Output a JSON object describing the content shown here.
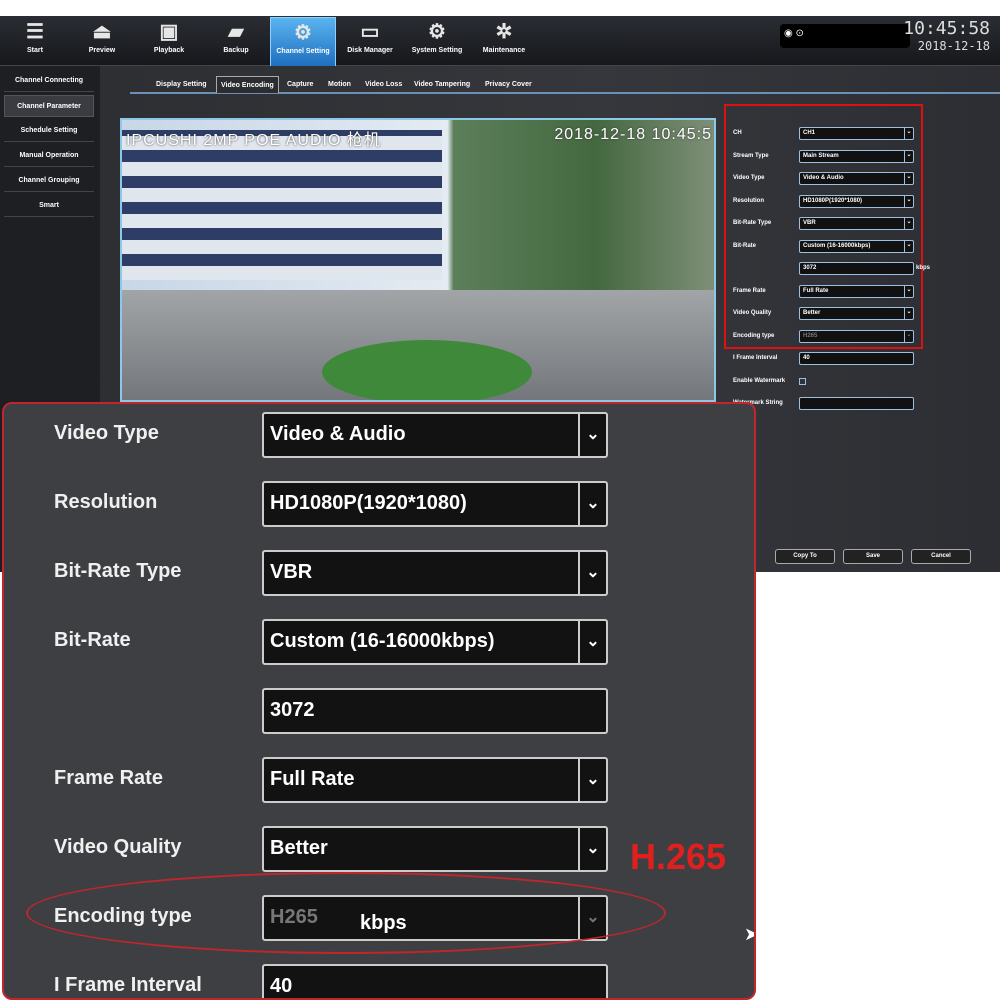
{
  "nav": [
    {
      "label": "Start",
      "icon": "list-icon"
    },
    {
      "label": "Preview",
      "icon": "camera-icon"
    },
    {
      "label": "Playback",
      "icon": "film-icon"
    },
    {
      "label": "Backup",
      "icon": "folder-icon"
    },
    {
      "label": "Channel Setting",
      "icon": "channel-gear-icon",
      "active": true
    },
    {
      "label": "Disk Manager",
      "icon": "disk-icon"
    },
    {
      "label": "System Setting",
      "icon": "system-gear-icon"
    },
    {
      "label": "Maintenance",
      "icon": "gear-icon"
    }
  ],
  "clock": {
    "time": "10:45:58",
    "date": "2018-12-18"
  },
  "sidebar": [
    "Channel Connecting",
    "Channel Parameter",
    "Schedule Setting",
    "Manual Operation",
    "Channel Grouping",
    "Smart"
  ],
  "tabs": [
    "Display Setting",
    "Video Encoding",
    "Capture",
    "Motion",
    "Video Loss",
    "Video Tampering",
    "Privacy Cover"
  ],
  "preview": {
    "osd_name": "IPCUSHI 2MP POE AUDIO 枪机",
    "osd_time": "2018-12-18 10:45:5"
  },
  "form": {
    "fields": [
      {
        "label": "CH",
        "value": "CH1",
        "type": "select"
      },
      {
        "label": "Stream Type",
        "value": "Main Stream",
        "type": "select"
      },
      {
        "label": "Video Type",
        "value": "Video & Audio",
        "type": "select"
      },
      {
        "label": "Resolution",
        "value": "HD1080P(1920*1080)",
        "type": "select"
      },
      {
        "label": "Bit-Rate Type",
        "value": "VBR",
        "type": "select"
      },
      {
        "label": "Bit-Rate",
        "value": "Custom (16-16000kbps)",
        "type": "select"
      },
      {
        "label": "",
        "value": "3072",
        "type": "input"
      },
      {
        "label": "Frame Rate",
        "value": "Full Rate",
        "type": "select"
      },
      {
        "label": "Video Quality",
        "value": "Better",
        "type": "select"
      },
      {
        "label": "Encoding type",
        "value": "H265",
        "type": "select",
        "disabled": true
      },
      {
        "label": "I Frame Interval",
        "value": "40",
        "type": "input"
      },
      {
        "label": "Enable Watermark",
        "value": "",
        "type": "checkbox"
      },
      {
        "label": "Watermark String",
        "value": "",
        "type": "input"
      }
    ],
    "unit": "kbps"
  },
  "buttons": {
    "copy": "Copy To",
    "save": "Save",
    "cancel": "Cancel"
  },
  "callout": {
    "annotation": "H.265"
  },
  "colors": {
    "accent": "#1f6fc0",
    "highlight": "#d11111"
  }
}
